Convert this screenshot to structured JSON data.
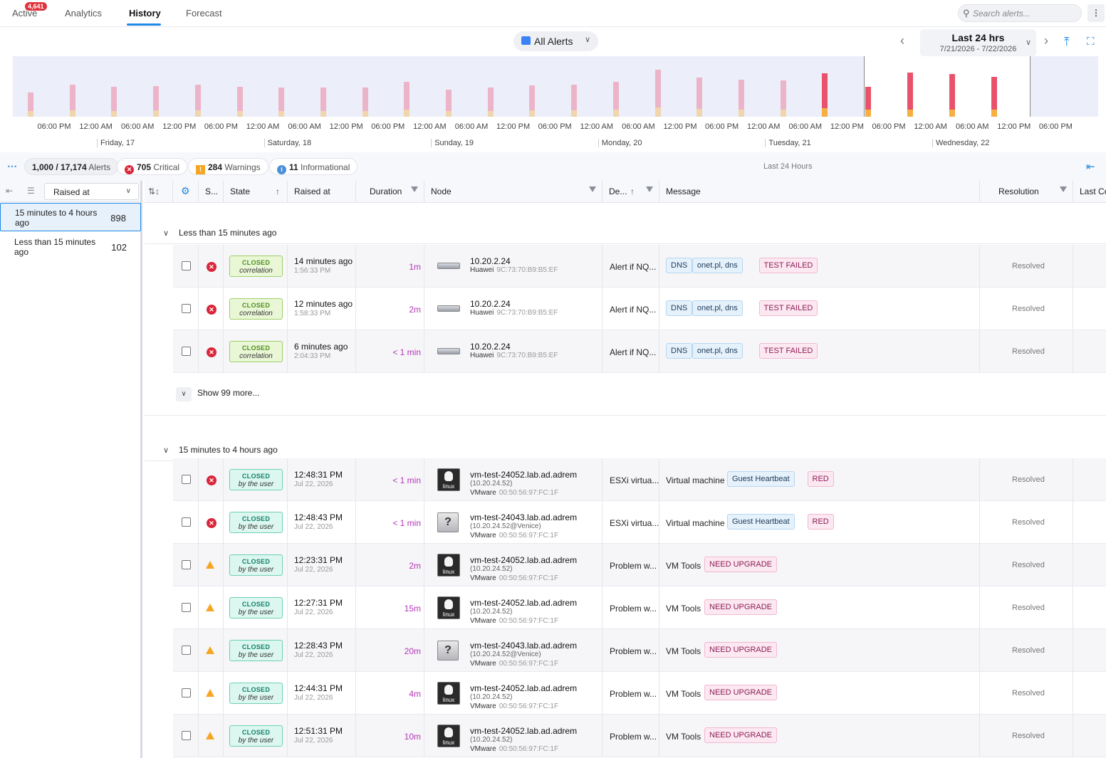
{
  "tabs": [
    {
      "label": "Active",
      "badge": "4,641"
    },
    {
      "label": "Analytics"
    },
    {
      "label": "History"
    },
    {
      "label": "Forecast"
    }
  ],
  "search": {
    "placeholder": "Search alerts..."
  },
  "filter": {
    "label": "All Alerts"
  },
  "range": {
    "title": "Last 24 hrs",
    "subtitle": "7/21/2026 - 7/22/2026"
  },
  "timeline": {
    "time_ticks": [
      "06:00 PM",
      "12:00 AM",
      "06:00 AM",
      "12:00 PM",
      "06:00 PM",
      "12:00 AM",
      "06:00 AM",
      "12:00 PM",
      "06:00 PM",
      "12:00 AM",
      "06:00 AM",
      "12:00 PM",
      "06:00 PM",
      "12:00 AM",
      "06:00 AM",
      "12:00 PM",
      "06:00 PM",
      "12:00 AM",
      "06:00 AM",
      "12:00 PM",
      "06:00 PM",
      "12:00 AM",
      "06:00 AM",
      "12:00 PM",
      "06:00 PM"
    ],
    "day_ticks": [
      "Friday, 17",
      "Saturday, 18",
      "Sunday, 19",
      "Monday, 20",
      "Tuesday, 21",
      "Wednesday, 22"
    ],
    "colors": {
      "critical": "#e8526a",
      "warning": "#f5b041",
      "info": "#7fb0e6",
      "faded_critical": "#ecb4c8",
      "faded_warning": "#f1d5ad"
    }
  },
  "summary": {
    "count": "1,000 / 17,174",
    "count_label": "Alerts",
    "critical_count": "705",
    "critical_label": "Critical",
    "warning_count": "284",
    "warning_label": "Warnings",
    "info_count": "11",
    "info_label": "Informational",
    "range_label": "Last 24 Hours"
  },
  "left_panel": {
    "group_by": "Raised at",
    "groups": [
      {
        "label": "15 minutes to 4 hours ago",
        "count": "898"
      },
      {
        "label": "Less than 15 minutes ago",
        "count": "102"
      }
    ]
  },
  "columns": {
    "severity": "S...",
    "state": "State",
    "raised": "Raised at",
    "duration": "Duration",
    "node": "Node",
    "description": "De...",
    "message": "Message",
    "resolution": "Resolution",
    "last": "Last Co"
  },
  "sections": [
    {
      "title": "Less than 15 minutes ago",
      "rows": [
        {
          "severity": "critical",
          "state": "CLOSED",
          "state_sub": "correlation",
          "raised": "14 minutes ago",
          "raised_sub": "1:56:33 PM",
          "duration": "1m",
          "node_icon": "server",
          "node_name": "10.20.2.24",
          "node_vendor": "Huawei",
          "node_mac": "9C:73:70:B9:B5:EF",
          "description": "Alert if NQ...",
          "message": "",
          "tags": [
            "DNS",
            "onet.pl, dns",
            "TEST FAILED"
          ],
          "resolution": "Resolved"
        },
        {
          "severity": "critical",
          "state": "CLOSED",
          "state_sub": "correlation",
          "raised": "12 minutes ago",
          "raised_sub": "1:58:33 PM",
          "duration": "2m",
          "node_icon": "server",
          "node_name": "10.20.2.24",
          "node_vendor": "Huawei",
          "node_mac": "9C:73:70:B9:B5:EF",
          "description": "Alert if NQ...",
          "message": "",
          "tags": [
            "DNS",
            "onet.pl, dns",
            "TEST FAILED"
          ],
          "resolution": "Resolved"
        },
        {
          "severity": "critical",
          "state": "CLOSED",
          "state_sub": "correlation",
          "raised": "6 minutes ago",
          "raised_sub": "2:04:33 PM",
          "duration": "< 1 min",
          "node_icon": "server",
          "node_name": "10.20.2.24",
          "node_vendor": "Huawei",
          "node_mac": "9C:73:70:B9:B5:EF",
          "description": "Alert if NQ...",
          "message": "",
          "tags": [
            "DNS",
            "onet.pl, dns",
            "TEST FAILED"
          ],
          "resolution": "Resolved"
        }
      ],
      "show_more": "Show 99 more..."
    },
    {
      "title": "15 minutes to 4 hours ago",
      "rows": [
        {
          "severity": "critical",
          "state": "CLOSED",
          "state_sub": "by the user",
          "raised": "12:48:31 PM",
          "raised_sub": "Jul 22, 2026",
          "duration": "< 1 min",
          "node_icon": "linux",
          "node_name": "vm-test-24052.lab.ad.adrem",
          "node_ip": "(10.20.24.52)",
          "node_vendor": "VMware",
          "node_mac": "00:50:56:97:FC:1F",
          "description": "ESXi virtua...",
          "message": "Virtual machine",
          "tags": [
            "Guest Heartbeat",
            "RED"
          ],
          "resolution": "Resolved"
        },
        {
          "severity": "critical",
          "state": "CLOSED",
          "state_sub": "by the user",
          "raised": "12:48:43 PM",
          "raised_sub": "Jul 22, 2026",
          "duration": "< 1 min",
          "node_icon": "unknown",
          "node_name": "vm-test-24043.lab.ad.adrem",
          "node_ip": "(10.20.24.52@Venice)",
          "node_vendor": "VMware",
          "node_mac": "00:50:56:97:FC:1F",
          "description": "ESXi virtua...",
          "message": "Virtual machine",
          "tags": [
            "Guest Heartbeat",
            "RED"
          ],
          "resolution": "Resolved"
        },
        {
          "severity": "warning",
          "state": "CLOSED",
          "state_sub": "by the user",
          "raised": "12:23:31 PM",
          "raised_sub": "Jul 22, 2026",
          "duration": "2m",
          "node_icon": "linux",
          "node_name": "vm-test-24052.lab.ad.adrem",
          "node_ip": "(10.20.24.52)",
          "node_vendor": "VMware",
          "node_mac": "00:50:56:97:FC:1F",
          "description": "Problem w...",
          "message": "VM Tools",
          "tags": [
            "NEED UPGRADE"
          ],
          "resolution": "Resolved"
        },
        {
          "severity": "warning",
          "state": "CLOSED",
          "state_sub": "by the user",
          "raised": "12:27:31 PM",
          "raised_sub": "Jul 22, 2026",
          "duration": "15m",
          "node_icon": "linux",
          "node_name": "vm-test-24052.lab.ad.adrem",
          "node_ip": "(10.20.24.52)",
          "node_vendor": "VMware",
          "node_mac": "00:50:56:97:FC:1F",
          "description": "Problem w...",
          "message": "VM Tools",
          "tags": [
            "NEED UPGRADE"
          ],
          "resolution": "Resolved"
        },
        {
          "severity": "warning",
          "state": "CLOSED",
          "state_sub": "by the user",
          "raised": "12:28:43 PM",
          "raised_sub": "Jul 22, 2026",
          "duration": "20m",
          "node_icon": "unknown",
          "node_name": "vm-test-24043.lab.ad.adrem",
          "node_ip": "(10.20.24.52@Venice)",
          "node_vendor": "VMware",
          "node_mac": "00:50:56:97:FC:1F",
          "description": "Problem w...",
          "message": "VM Tools",
          "tags": [
            "NEED UPGRADE"
          ],
          "resolution": "Resolved"
        },
        {
          "severity": "warning",
          "state": "CLOSED",
          "state_sub": "by the user",
          "raised": "12:44:31 PM",
          "raised_sub": "Jul 22, 2026",
          "duration": "4m",
          "node_icon": "linux",
          "node_name": "vm-test-24052.lab.ad.adrem",
          "node_ip": "(10.20.24.52)",
          "node_vendor": "VMware",
          "node_mac": "00:50:56:97:FC:1F",
          "description": "Problem w...",
          "message": "VM Tools",
          "tags": [
            "NEED UPGRADE"
          ],
          "resolution": "Resolved"
        },
        {
          "severity": "warning",
          "state": "CLOSED",
          "state_sub": "by the user",
          "raised": "12:51:31 PM",
          "raised_sub": "Jul 22, 2026",
          "duration": "10m",
          "node_icon": "linux",
          "node_name": "vm-test-24052.lab.ad.adrem",
          "node_ip": "(10.20.24.52)",
          "node_vendor": "VMware",
          "node_mac": "00:50:56:97:FC:1F",
          "description": "Problem w...",
          "message": "VM Tools",
          "tags": [
            "NEED UPGRADE"
          ],
          "resolution": "Resolved"
        }
      ]
    }
  ]
}
